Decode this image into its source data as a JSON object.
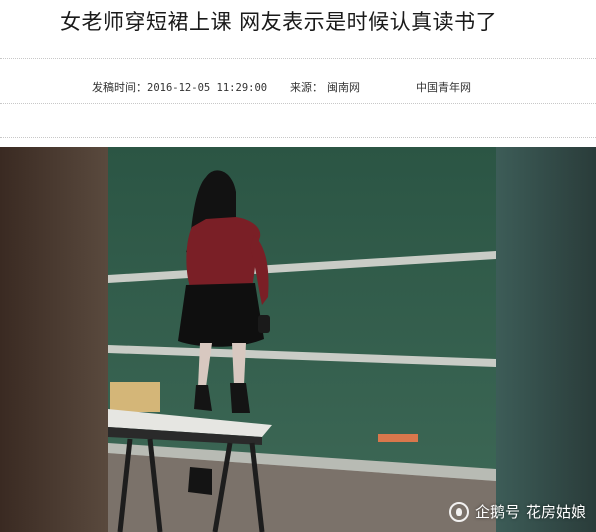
{
  "article": {
    "title": "女老师穿短裙上课 网友表示是时候认真读书了",
    "meta": {
      "time_label": "发稿时间：",
      "time_value": "2016-12-05 11:29:00",
      "source_label": "来源：",
      "source_value": "闽南网",
      "outlet": "中国青年网"
    }
  },
  "image": {
    "subject": "classroom-blackboard-photo",
    "watermark": {
      "icon": "penguin-icon",
      "platform": "企鹅号",
      "account": "花房姑娘"
    }
  },
  "colors": {
    "blackboard": "#2f5a45",
    "sweater": "#7a1f26",
    "skirt": "#111111"
  }
}
